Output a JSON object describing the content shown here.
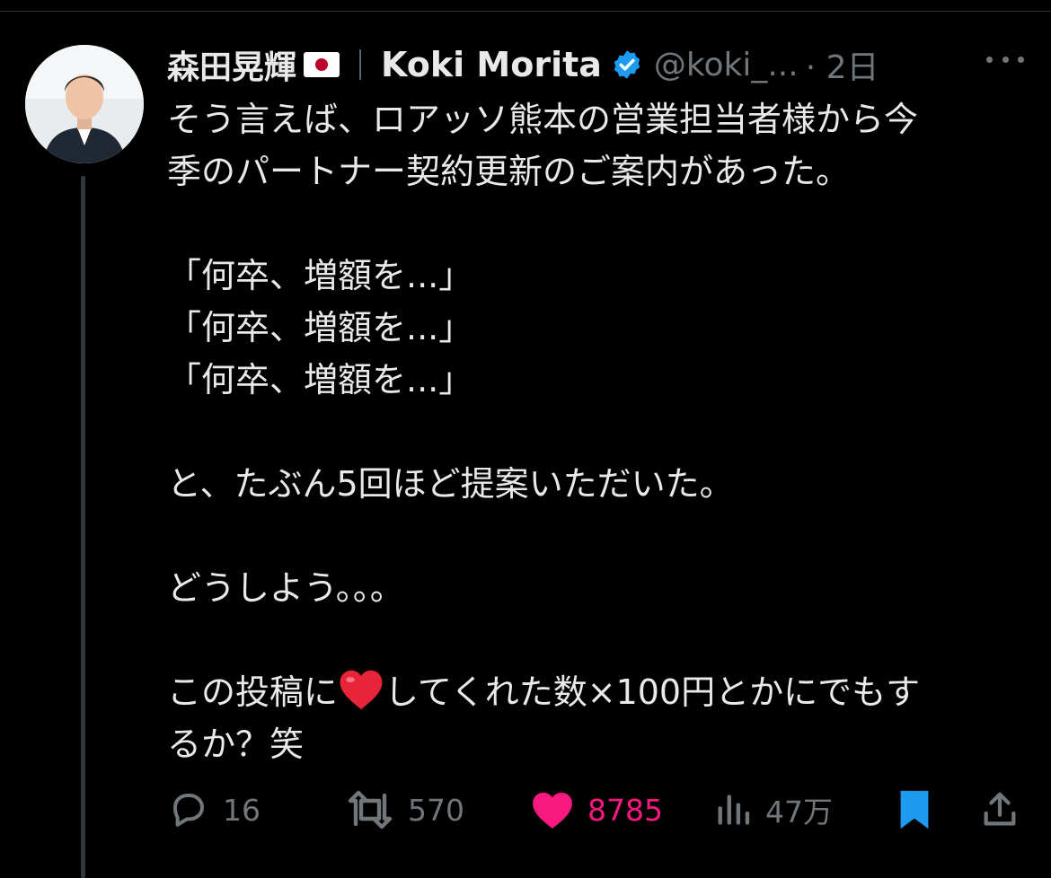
{
  "tweet": {
    "author_name": "森田晃輝",
    "display_name": "Koki Morita",
    "handle": "@koki_...",
    "time": "· 2日",
    "lines": {
      "l1": "そう言えば、ロアッソ熊本の営業担当者様から今",
      "l2": "季のパートナー契約更新のご案内があった。",
      "q1": "「何卒、増額を...」",
      "q2": "「何卒、増額を...」",
      "q3": "「何卒、増額を...」",
      "l3": "と、たぶん5回ほど提案いただいた。",
      "l4": "どうしよう。。。",
      "l5a": "この投稿に",
      "l5b": "してくれた数×100円とかにでもす",
      "l6": "るか？笑"
    }
  },
  "icons": {
    "flag": "japan-flag-icon",
    "verified": "verified-badge-icon",
    "more": "more-icon",
    "emoji": "red-heart-emoji",
    "reply": "reply-icon",
    "retweet": "retweet-icon",
    "like": "like-icon",
    "views": "views-icon",
    "bookmark": "bookmark-icon",
    "share": "share-icon"
  },
  "actions": {
    "replies": "16",
    "retweets": "570",
    "likes": "8785",
    "views": "47万"
  },
  "colors": {
    "background": "#000000",
    "text": "#e7e9ea",
    "muted": "#71767b",
    "verified": "#1d9bf0",
    "like": "#f91880",
    "bookmark": "#1d9bf0"
  }
}
